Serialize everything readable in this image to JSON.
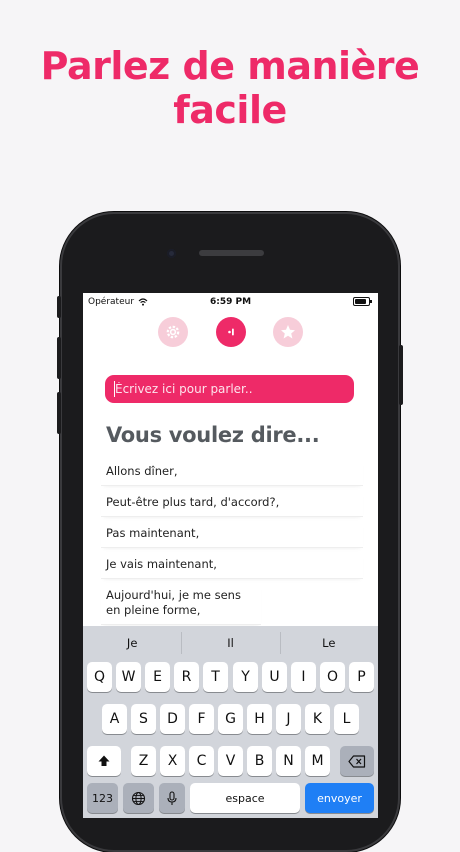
{
  "headline": {
    "line1": "Parlez de manière",
    "line2": "facile"
  },
  "status_bar": {
    "carrier": "Opérateur",
    "time": "6:59 PM"
  },
  "toolbar": {
    "icons": [
      "gear-icon",
      "speak-icon",
      "star-icon"
    ]
  },
  "input": {
    "placeholder": "Écrivez ici pour parler.."
  },
  "section_title": "Vous voulez dire...",
  "suggestions": [
    "Allons dîner,",
    "Peut-être plus tard, d'accord?,",
    "Pas maintenant,",
    "Je vais maintenant,",
    "Aujourd'hui, je me sens en pleine forme,"
  ],
  "keyboard": {
    "predictions": [
      "Je",
      "Il",
      "Le"
    ],
    "row1": [
      "Q",
      "W",
      "E",
      "R",
      "T",
      "Y",
      "U",
      "I",
      "O",
      "P"
    ],
    "row2": [
      "A",
      "S",
      "D",
      "F",
      "G",
      "H",
      "J",
      "K",
      "L"
    ],
    "row3": [
      "Z",
      "X",
      "C",
      "V",
      "B",
      "N",
      "M"
    ],
    "numbers_key": "123",
    "space_key": "espace",
    "send_key": "envoyer"
  },
  "colors": {
    "accent": "#ee2a68",
    "accent_light": "#f7cdd9",
    "send": "#1f7ff5",
    "title": "#555a5f"
  }
}
